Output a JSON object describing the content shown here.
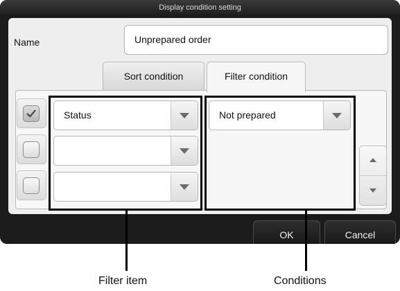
{
  "dialog": {
    "title": "Display condition setting",
    "name_label": "Name",
    "name_value": "Unprepared order",
    "tabs": [
      {
        "label": "Sort condition",
        "active": false
      },
      {
        "label": "Filter condition",
        "active": true
      }
    ],
    "rows": [
      {
        "checked": true,
        "filter_item": "Status",
        "condition": "Not prepared"
      },
      {
        "checked": false,
        "filter_item": "",
        "condition": ""
      },
      {
        "checked": false,
        "filter_item": "",
        "condition": ""
      }
    ],
    "buttons": {
      "ok": "OK",
      "cancel": "Cancel"
    }
  },
  "callouts": {
    "filter_item": "Filter item",
    "conditions": "Conditions"
  }
}
